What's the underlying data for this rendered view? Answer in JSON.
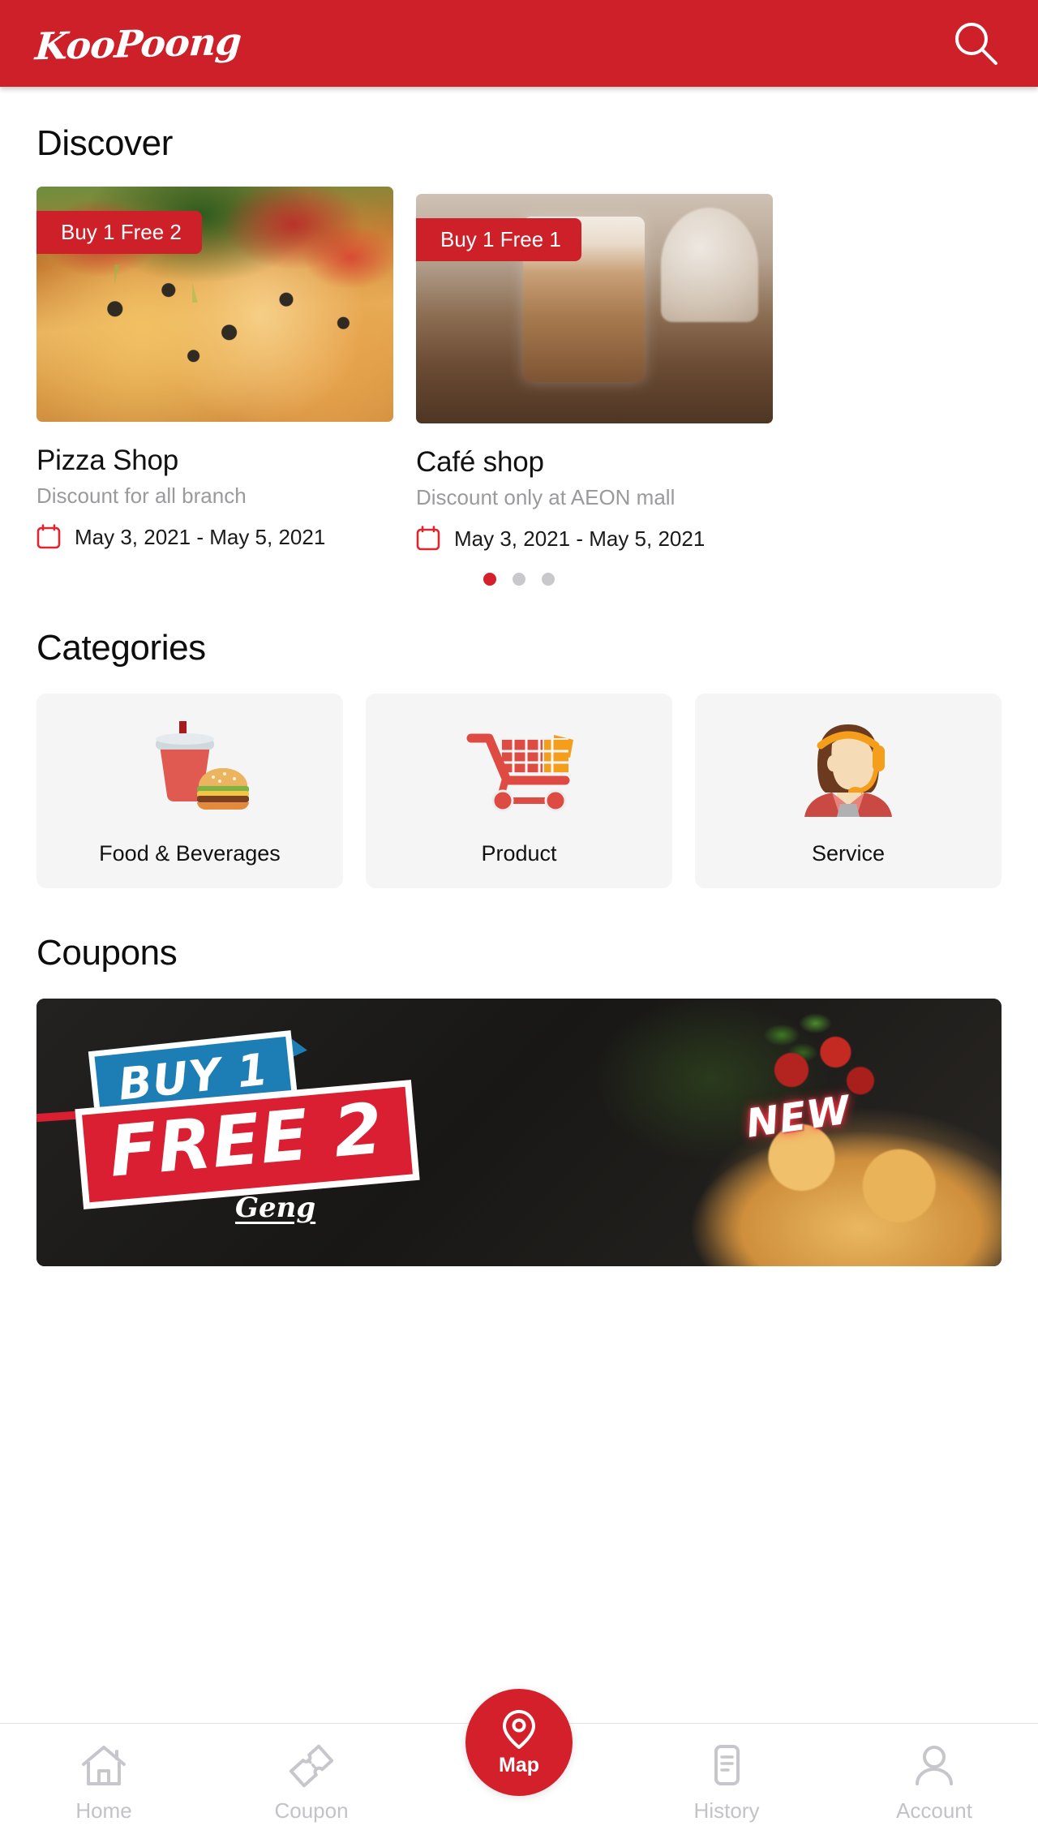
{
  "header": {
    "brand": "KooPoong",
    "search_icon": "search-icon",
    "brand_color": "#CE2029"
  },
  "discover": {
    "title": "Discover",
    "cards": [
      {
        "badge": "Buy 1 Free 2",
        "name": "Pizza Shop",
        "subtitle": "Discount for all branch",
        "date": "May 3, 2021 - May 5, 2021",
        "calendar_icon": "calendar-icon",
        "image": "pizza-photo"
      },
      {
        "badge": "Buy 1 Free 1",
        "name": "Café shop",
        "subtitle": "Discount only at AEON mall",
        "date": "May 3, 2021 - May 5, 2021",
        "calendar_icon": "calendar-icon",
        "image": "iced-coffee-photo"
      }
    ],
    "pagination": {
      "total": 3,
      "active": 0,
      "active_color": "#D3202A",
      "inactive_color": "#C9C9CC"
    }
  },
  "categories": {
    "title": "Categories",
    "items": [
      {
        "label": "Food & Beverages",
        "icon": "soda-and-burger-icon"
      },
      {
        "label": "Product",
        "icon": "shopping-cart-icon"
      },
      {
        "label": "Service",
        "icon": "customer-service-agent-icon"
      }
    ]
  },
  "coupons": {
    "title": "Coupons",
    "banner": {
      "tag_buy": "BUY 1",
      "tag_free": "FREE 2",
      "tag_new": "NEW",
      "brand_mark": "Geng",
      "image": "pizza-promo-photo"
    }
  },
  "bottom_nav": {
    "items": [
      {
        "label": "Home",
        "icon": "home-icon",
        "active": false
      },
      {
        "label": "Coupon",
        "icon": "ticket-icon",
        "active": false
      },
      {
        "label": "History",
        "icon": "document-icon",
        "active": false
      },
      {
        "label": "Account",
        "icon": "person-icon",
        "active": false
      }
    ],
    "fab": {
      "label": "Map",
      "icon": "map-pin-icon",
      "color": "#D3202A"
    }
  }
}
